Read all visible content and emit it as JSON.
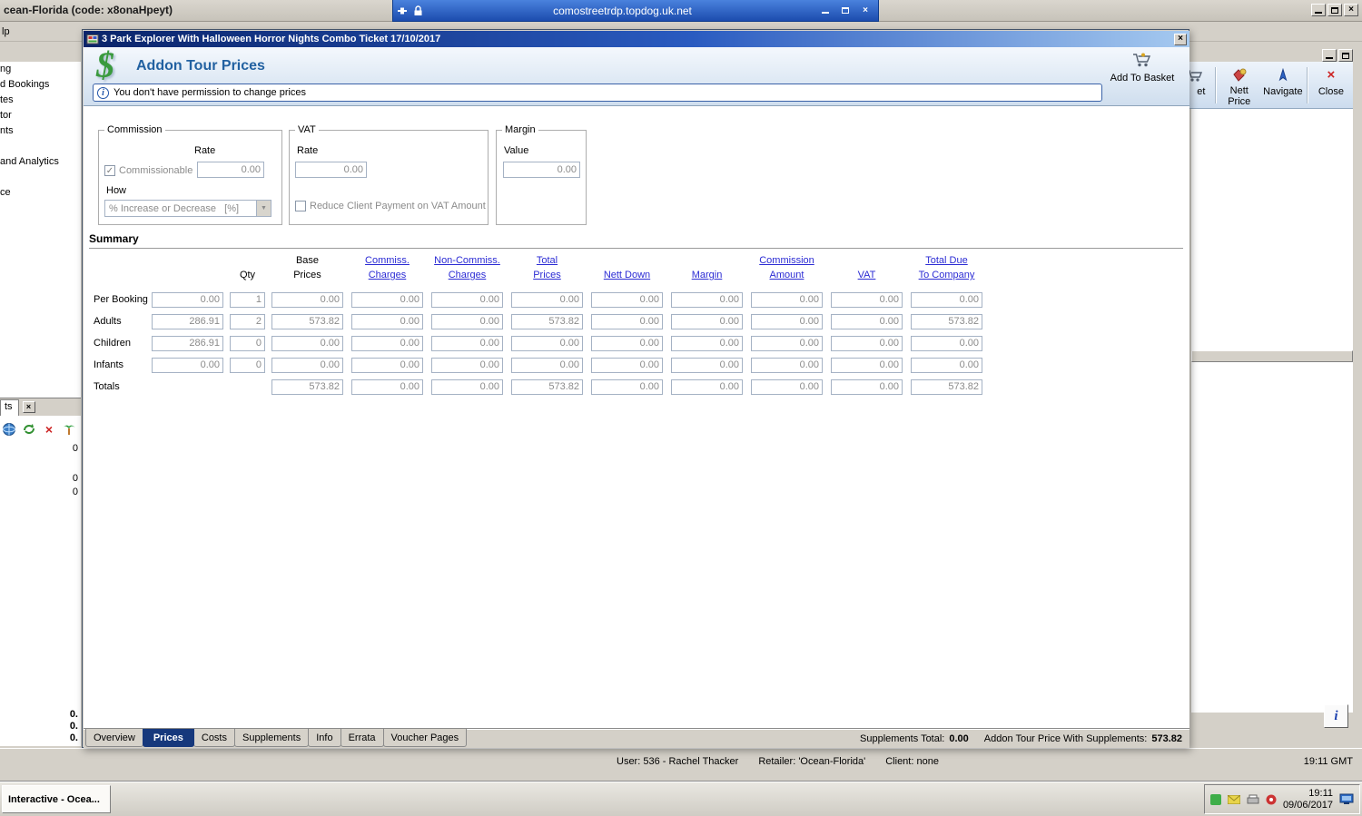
{
  "icons": {
    "close_glyph": "×",
    "dropdown_arrow": "▼",
    "check_mark": "✓",
    "info_letter": "i",
    "dollar_sign": "$"
  },
  "host": {
    "window_title": "cean-Florida (code: x8onaHpeyt)",
    "menu_fragment": "lp",
    "rdp": {
      "address": "comostreetrdp.topdog.uk.net"
    },
    "toolbar": {
      "clipped_button_label": "et",
      "nett_price_label": "Nett Price",
      "navigate_label": "Navigate",
      "close_label": "Close"
    },
    "sidebar_fragments": [
      "ng",
      "d Bookings",
      "tes",
      "tor",
      "nts",
      "and Analytics",
      "ce"
    ],
    "left_pane": {
      "tab_label": "ts",
      "values": [
        "0",
        "0",
        "0"
      ],
      "bottom_values": [
        "0.",
        "0.",
        "0."
      ]
    },
    "status_bar": {
      "user_text": "User: 536 - Rachel Thacker",
      "retailer_text": "Retailer: 'Ocean-Florida'",
      "client_text": "Client: none",
      "clock": "19:11 GMT"
    },
    "taskbar": {
      "app_button_label": "Interactive - Ocea...",
      "tray_time": "19:11",
      "tray_date": "09/06/2017"
    }
  },
  "dialog": {
    "title": "3 Park Explorer With Halloween Horror Nights Combo Ticket 17/10/2017",
    "header_title": "Addon Tour Prices",
    "add_to_basket_label": "Add To Basket",
    "permission_message": "You don't have permission to change prices",
    "commission": {
      "legend": "Commission",
      "rate_label": "Rate",
      "commissionable_label": "Commissionable",
      "commissionable_checked": true,
      "rate_value": "0.00",
      "how_label": "How",
      "how_value": "% Increase or Decrease   [%]"
    },
    "vat": {
      "legend": "VAT",
      "rate_label": "Rate",
      "rate_value": "0.00",
      "reduce_vat_label": "Reduce Client Payment on VAT Amount",
      "reduce_vat_checked": false
    },
    "margin": {
      "legend": "Margin",
      "value_label": "Value",
      "value": "0.00"
    },
    "summary": {
      "title": "Summary",
      "col_headers": [
        {
          "top": "",
          "bottom": "Qty",
          "link": false
        },
        {
          "top": "Base",
          "bottom": "Prices",
          "link": false
        },
        {
          "top": "Commiss.",
          "bottom": "Charges",
          "link": true
        },
        {
          "top": "Non-Commiss.",
          "bottom": "Charges",
          "link": true
        },
        {
          "top": "Total",
          "bottom": "Prices",
          "link": true
        },
        {
          "top": "",
          "bottom": "Nett Down",
          "link": true
        },
        {
          "top": "",
          "bottom": "Margin",
          "link": true
        },
        {
          "top": "Commission",
          "bottom": "Amount",
          "link": true
        },
        {
          "top": "",
          "bottom": "VAT",
          "link": true
        },
        {
          "top": "Total Due",
          "bottom": "To Company",
          "link": true
        }
      ],
      "rows": [
        {
          "label": "Per Booking",
          "rate": "0.00",
          "qty": "1",
          "cells": [
            "0.00",
            "0.00",
            "0.00",
            "0.00",
            "0.00",
            "0.00",
            "0.00",
            "0.00",
            "0.00"
          ]
        },
        {
          "label": "Adults",
          "rate": "286.91",
          "qty": "2",
          "cells": [
            "573.82",
            "0.00",
            "0.00",
            "573.82",
            "0.00",
            "0.00",
            "0.00",
            "0.00",
            "573.82"
          ]
        },
        {
          "label": "Children",
          "rate": "286.91",
          "qty": "0",
          "cells": [
            "0.00",
            "0.00",
            "0.00",
            "0.00",
            "0.00",
            "0.00",
            "0.00",
            "0.00",
            "0.00"
          ]
        },
        {
          "label": "Infants",
          "rate": "0.00",
          "qty": "0",
          "cells": [
            "0.00",
            "0.00",
            "0.00",
            "0.00",
            "0.00",
            "0.00",
            "0.00",
            "0.00",
            "0.00"
          ]
        },
        {
          "label": "Totals",
          "rate": null,
          "qty": null,
          "cells": [
            "573.82",
            "0.00",
            "0.00",
            "573.82",
            "0.00",
            "0.00",
            "0.00",
            "0.00",
            "573.82"
          ]
        }
      ]
    },
    "tabs": [
      {
        "label": "Overview",
        "active": false
      },
      {
        "label": "Prices",
        "active": true
      },
      {
        "label": "Costs",
        "active": false
      },
      {
        "label": "Supplements",
        "active": false
      },
      {
        "label": "Info",
        "active": false
      },
      {
        "label": "Errata",
        "active": false
      },
      {
        "label": "Voucher Pages",
        "active": false
      }
    ],
    "footer": {
      "supplements_total_label": "Supplements Total:",
      "supplements_total_value": "0.00",
      "with_supplements_label": "Addon Tour Price With Supplements:",
      "with_supplements_value": "573.82"
    }
  }
}
